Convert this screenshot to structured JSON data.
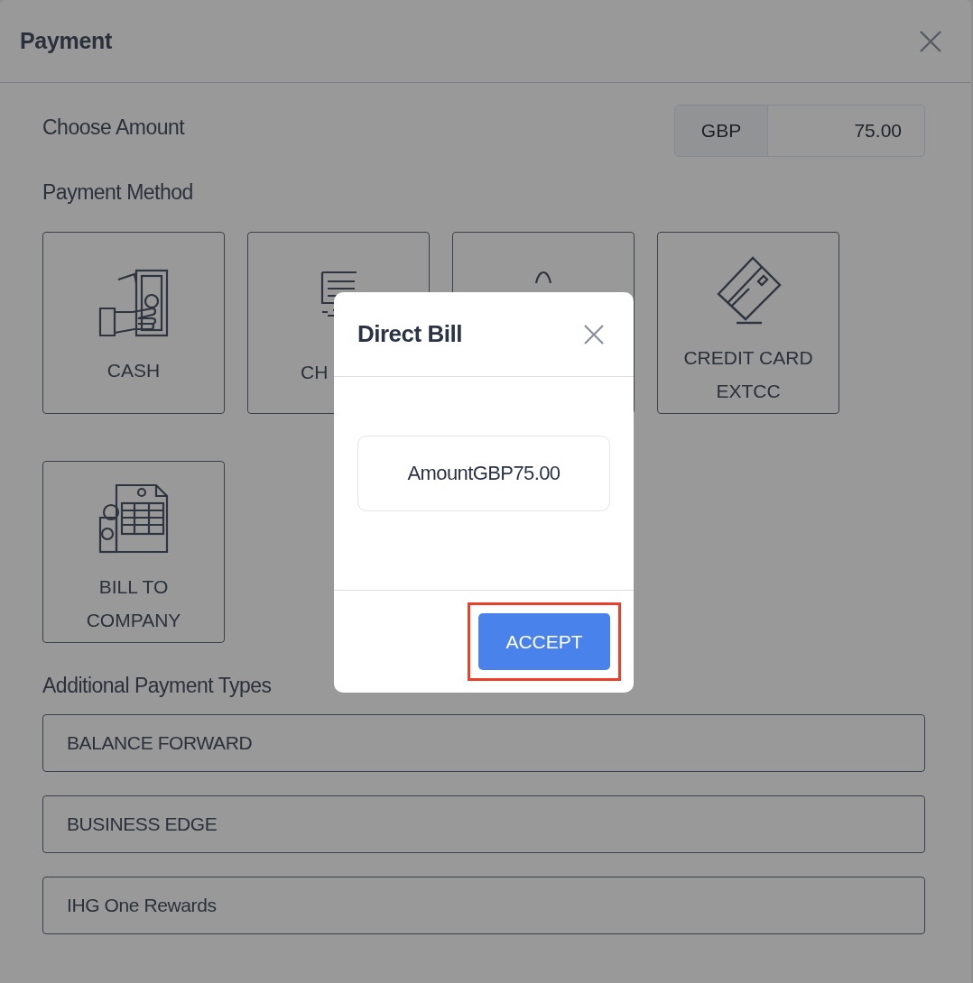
{
  "window": {
    "title": "Payment"
  },
  "amount": {
    "label": "Choose Amount",
    "currency": "GBP",
    "value": "75.00"
  },
  "payment_method": {
    "label": "Payment Method",
    "tiles": [
      {
        "kind": "cash",
        "label": "CASH",
        "covered": false
      },
      {
        "kind": "cheque",
        "label": "CH",
        "covered": true
      },
      {
        "kind": "bag"
      },
      {
        "kind": "card",
        "label": "CREDIT CARD EXTCC",
        "covered": false
      },
      {
        "kind": "invoice",
        "label": "BILL TO COMPANY",
        "covered": false
      }
    ]
  },
  "additional": {
    "label": "Additional Payment Types",
    "items": [
      "BALANCE FORWARD",
      "BUSINESS EDGE",
      "IHG One Rewards"
    ]
  },
  "dialog": {
    "title": "Direct Bill",
    "amount_text": "AmountGBP75.00",
    "button": "ACCEPT",
    "highlighted": true
  }
}
